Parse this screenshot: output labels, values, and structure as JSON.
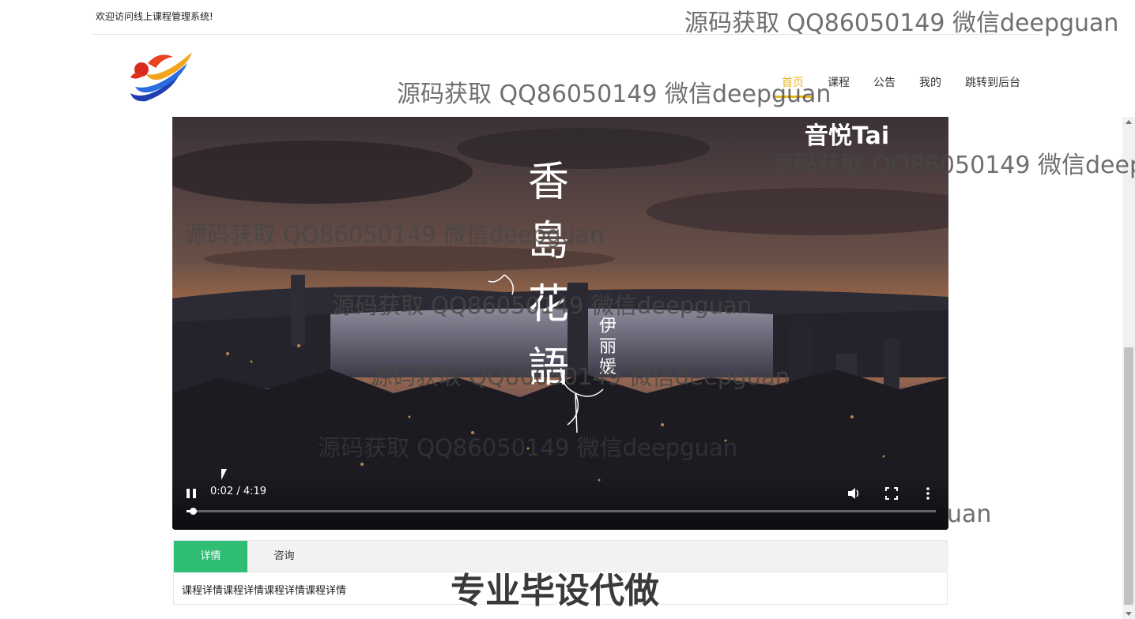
{
  "topbar": {
    "welcome": "欢迎访问线上课程管理系统!"
  },
  "nav": {
    "items": [
      {
        "label": "首页",
        "active": true
      },
      {
        "label": "课程"
      },
      {
        "label": "公告"
      },
      {
        "label": "我的"
      },
      {
        "label": "跳转到后台"
      }
    ]
  },
  "video": {
    "overlay_title": "香島花語",
    "overlay_artist": "伊丽媛",
    "overlay_brand": "音悦Tai",
    "current_time": "0:02",
    "duration": "4:19",
    "time_display": "0:02 / 4:19",
    "progress_fraction": 0.008
  },
  "tabs": {
    "items": [
      {
        "label": "详情",
        "active": true
      },
      {
        "label": "咨询"
      }
    ],
    "content": "课程详情课程详情课程详情课程详情"
  },
  "watermarks": {
    "text": "源码获取 QQ86050149 微信deepguan",
    "partial_right": "源码获取 QQ86050149 微信deep",
    "partial_left": "uan",
    "banner": "专业毕设代做"
  },
  "colors": {
    "accent": "#e8b722",
    "tab_active": "#2fbd74"
  }
}
